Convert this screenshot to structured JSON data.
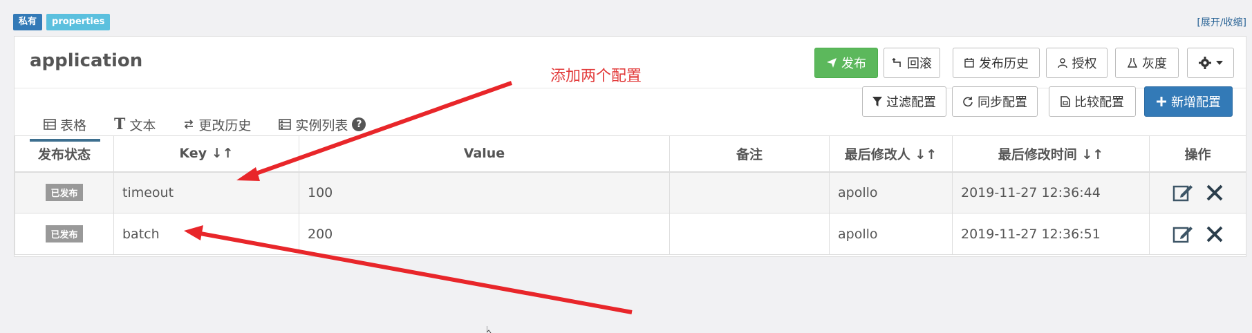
{
  "labels": {
    "private": "私有",
    "format": "properties"
  },
  "toggle": "[展开/收缩]",
  "namespace": {
    "title": "application"
  },
  "toolbar": {
    "publish": "发布",
    "rollback": "回滚",
    "history": "发布历史",
    "grant": "授权",
    "gray": "灰度"
  },
  "tabs": [
    "表格",
    "文本",
    "更改历史",
    "实例列表"
  ],
  "instance_badge": "?",
  "actions": {
    "filter": "过滤配置",
    "sync": "同步配置",
    "compare": "比较配置",
    "add": "新增配置"
  },
  "table": {
    "headers": [
      "发布状态",
      "Key",
      "Value",
      "备注",
      "最后修改人",
      "最后修改时间",
      "操作"
    ],
    "rows": [
      {
        "status": "已发布",
        "key": "timeout",
        "value": "100",
        "comment": "",
        "modifier": "apollo",
        "time": "2019-11-27 12:36:44"
      },
      {
        "status": "已发布",
        "key": "batch",
        "value": "200",
        "comment": "",
        "modifier": "apollo",
        "time": "2019-11-27 12:36:51"
      }
    ]
  },
  "annotation": "添加两个配置",
  "colors": {
    "primary": "#337ab7",
    "success": "#5cb85c",
    "info": "#5bc0de",
    "annotation": "#e8262a"
  }
}
